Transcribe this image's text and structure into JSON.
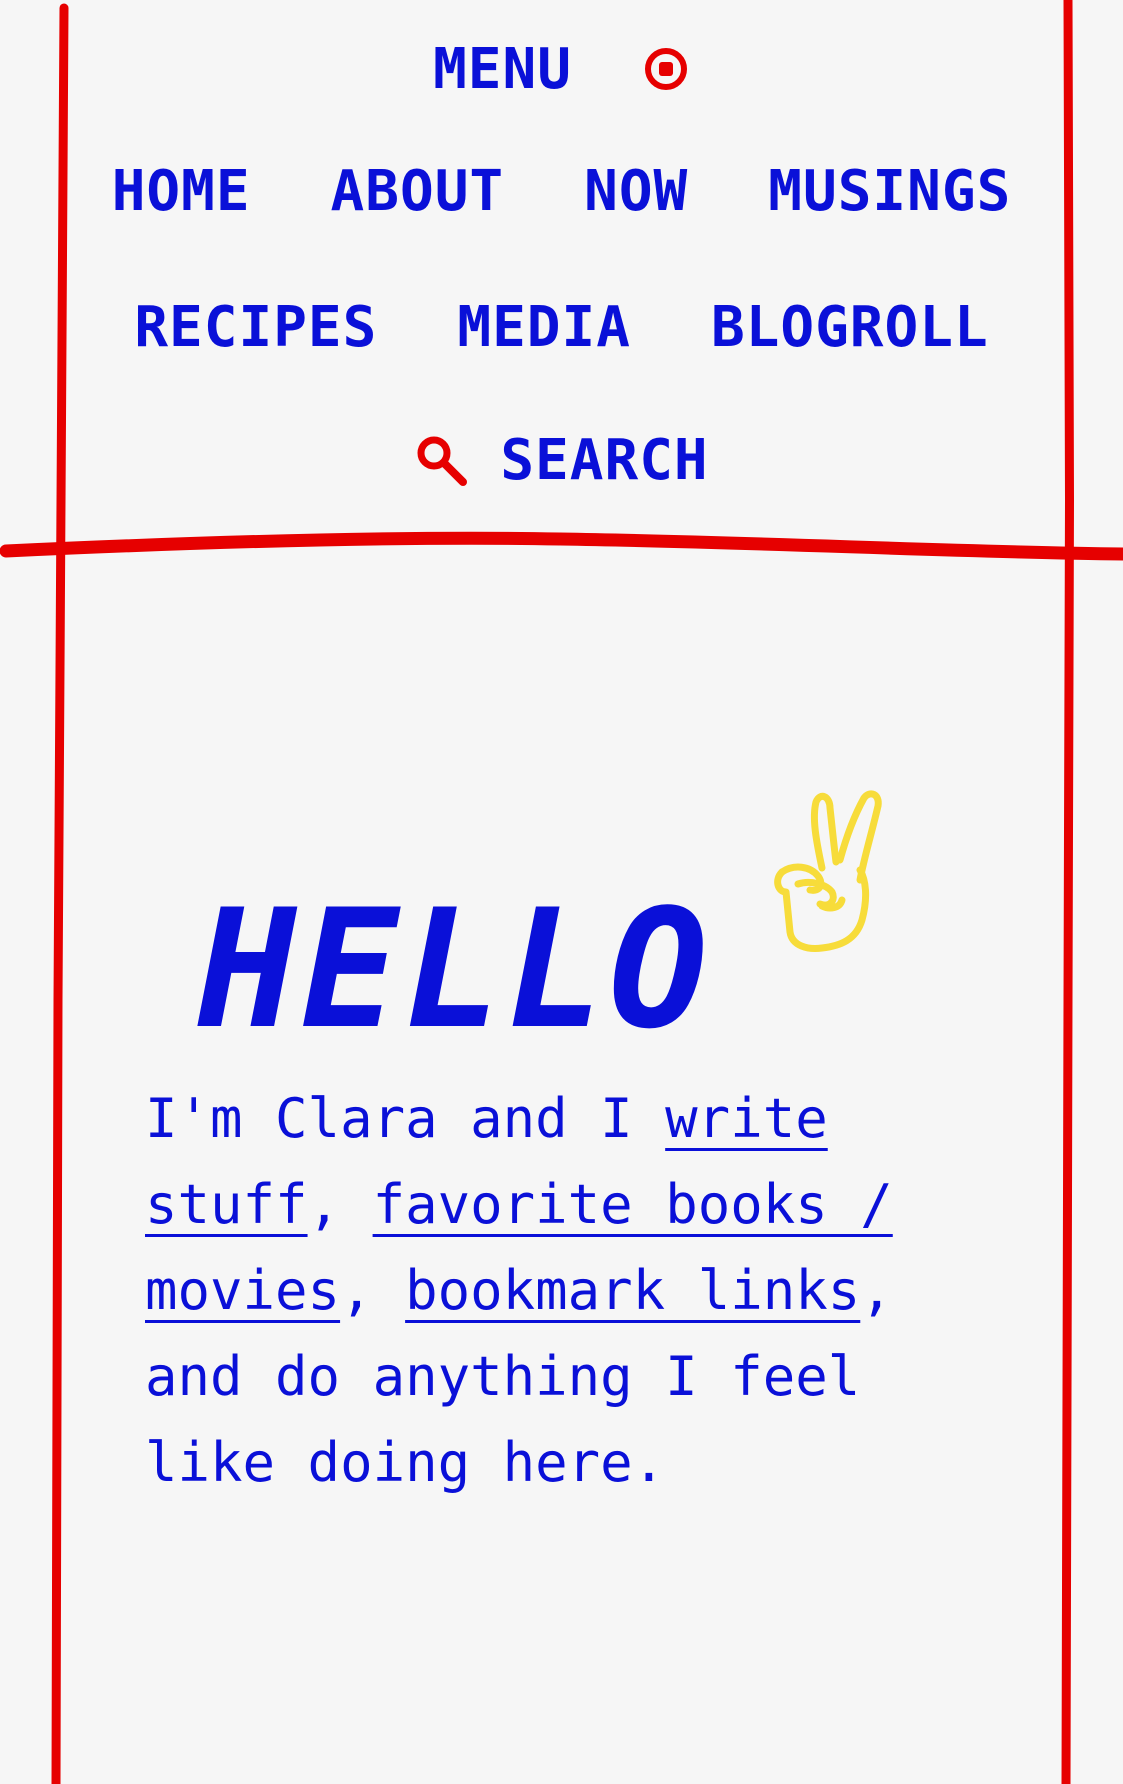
{
  "menu": {
    "label": "MENU",
    "icon": "target-icon"
  },
  "nav": {
    "row1": [
      "HOME",
      "ABOUT",
      "NOW",
      "MUSINGS"
    ],
    "row2": [
      "RECIPES",
      "MEDIA",
      "BLOGROLL"
    ],
    "search_label": "SEARCH",
    "search_icon": "search-icon"
  },
  "hero": {
    "title": "HELLO",
    "icon": "peace-hand-icon"
  },
  "intro": {
    "t1": "I'm Clara and I ",
    "link1": "write stuff",
    "t2": ", ",
    "link2": "favorite books / movies",
    "t3": ", ",
    "link3": "bookmark links",
    "t4": ", and do anything I feel like doing here."
  },
  "colors": {
    "text": "#0a10d8",
    "accent": "#e60000",
    "background": "#f6f6f6",
    "icon_yellow": "#f7dc3a"
  }
}
